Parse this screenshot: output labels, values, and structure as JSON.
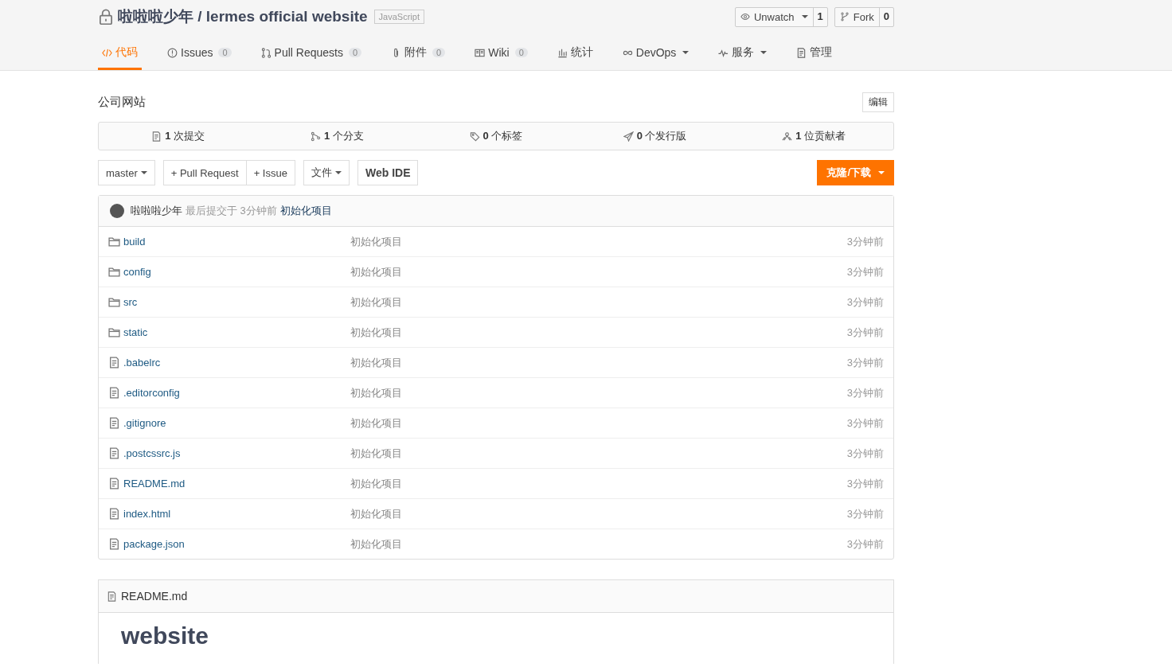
{
  "repo": {
    "owner": "啦啦啦少年",
    "separator": "/",
    "name": "lermes official website",
    "language": "JavaScript",
    "private": true
  },
  "watch": {
    "label": "Unwatch",
    "count": "1"
  },
  "fork": {
    "label": "Fork",
    "count": "0"
  },
  "tabs": [
    {
      "label": "代码",
      "selected": true
    },
    {
      "label": "Issues",
      "count": "0",
      "selected": false
    },
    {
      "label": "Pull Requests",
      "count": "0",
      "selected": false
    },
    {
      "label": "附件",
      "count": "0",
      "selected": false
    },
    {
      "label": "Wiki",
      "count": "0",
      "selected": false
    },
    {
      "label": "统计",
      "selected": false
    },
    {
      "label": "DevOps",
      "dropdown": true,
      "selected": false
    },
    {
      "label": "服务",
      "dropdown": true,
      "selected": false
    },
    {
      "label": "管理",
      "selected": false
    }
  ],
  "description": "公司网站",
  "edit_button": "编辑",
  "stats": [
    "**1** 次提交",
    "**1** 个分支",
    "**0** 个标签",
    "**0** 个发行版",
    "**1** 位贡献者"
  ],
  "branch": "master",
  "actions": [
    "+ Pull Request",
    "+ Issue"
  ],
  "file_menu": "文件",
  "web_ide": "Web IDE",
  "clone_button": "克隆/下载",
  "last_commit": {
    "author": "啦啦啦少年",
    "info": "最后提交于 3分钟前",
    "message": "初始化项目"
  },
  "files": [
    {
      "kind": "folder",
      "name": "build",
      "message": "初始化项目",
      "time": "3分钟前"
    },
    {
      "kind": "folder",
      "name": "config",
      "message": "初始化项目",
      "time": "3分钟前"
    },
    {
      "kind": "folder",
      "name": "src",
      "message": "初始化项目",
      "time": "3分钟前"
    },
    {
      "kind": "folder",
      "name": "static",
      "message": "初始化项目",
      "time": "3分钟前"
    },
    {
      "kind": "file",
      "name": ".babelrc",
      "message": "初始化项目",
      "time": "3分钟前"
    },
    {
      "kind": "file",
      "name": ".editorconfig",
      "message": "初始化项目",
      "time": "3分钟前"
    },
    {
      "kind": "file",
      "name": ".gitignore",
      "message": "初始化项目",
      "time": "3分钟前"
    },
    {
      "kind": "file",
      "name": ".postcssrc.js",
      "message": "初始化项目",
      "time": "3分钟前"
    },
    {
      "kind": "file",
      "name": "README.md",
      "message": "初始化项目",
      "time": "3分钟前"
    },
    {
      "kind": "file",
      "name": "index.html",
      "message": "初始化项目",
      "time": "3分钟前"
    },
    {
      "kind": "file",
      "name": "package.json",
      "message": "初始化项目",
      "time": "3分钟前"
    }
  ],
  "readme": {
    "filename": "README.md",
    "heading": "website"
  }
}
